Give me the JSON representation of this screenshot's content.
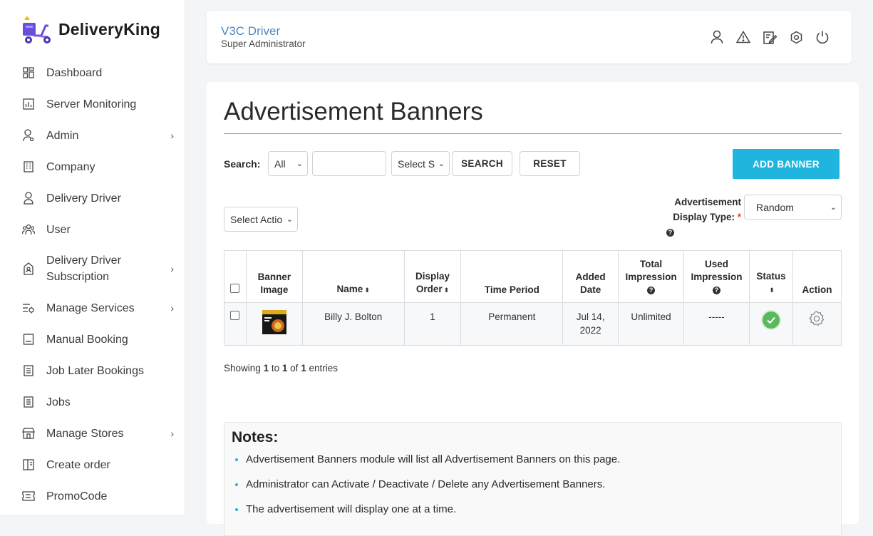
{
  "brand": {
    "name": "DeliveryKing"
  },
  "sidebar": {
    "items": [
      {
        "label": "Dashboard",
        "icon": "dashboard-icon",
        "has_submenu": false
      },
      {
        "label": "Server Monitoring",
        "icon": "chart-icon",
        "has_submenu": false
      },
      {
        "label": "Admin",
        "icon": "admin-user-icon",
        "has_submenu": true
      },
      {
        "label": "Company",
        "icon": "building-icon",
        "has_submenu": false
      },
      {
        "label": "Delivery Driver",
        "icon": "driver-icon",
        "has_submenu": false
      },
      {
        "label": "User",
        "icon": "users-icon",
        "has_submenu": false
      },
      {
        "label": "Delivery Driver Subscription",
        "icon": "subscription-icon",
        "has_submenu": true
      },
      {
        "label": "Manage Services",
        "icon": "services-icon",
        "has_submenu": true
      },
      {
        "label": "Manual Booking",
        "icon": "booking-icon",
        "has_submenu": false
      },
      {
        "label": "Job Later Bookings",
        "icon": "document-icon",
        "has_submenu": false
      },
      {
        "label": "Jobs",
        "icon": "document-icon",
        "has_submenu": false
      },
      {
        "label": "Manage Stores",
        "icon": "store-icon",
        "has_submenu": true
      },
      {
        "label": "Create order",
        "icon": "order-icon",
        "has_submenu": false
      },
      {
        "label": "PromoCode",
        "icon": "promo-icon",
        "has_submenu": false
      }
    ],
    "chevron": "›"
  },
  "header": {
    "title": "V3C Driver",
    "subtitle": "Super Administrator",
    "icons": [
      "profile-icon",
      "alert-icon",
      "edit-icon",
      "settings-icon",
      "power-icon"
    ]
  },
  "page": {
    "title": "Advertisement Banners"
  },
  "toolbar": {
    "search_label": "Search:",
    "filter_value": "All",
    "search_input_value": "",
    "status_select_value": "Select S",
    "search_button": "SEARCH",
    "reset_button": "RESET",
    "add_button": "ADD BANNER",
    "bulk_action_value": "Select Actio",
    "ad_display_label": "Advertisement Display Type:",
    "ad_display_required": "*",
    "ad_display_value": "Random",
    "help_glyph": "?"
  },
  "table": {
    "columns": [
      {
        "label": "",
        "sortable": false
      },
      {
        "label": "Banner Image",
        "sortable": false
      },
      {
        "label": "Name",
        "sortable": true
      },
      {
        "label": "Display Order",
        "sortable": true
      },
      {
        "label": "Time Period",
        "sortable": false
      },
      {
        "label": "Added Date",
        "sortable": false
      },
      {
        "label": "Total Impression",
        "sortable": false,
        "help": true
      },
      {
        "label": "Used Impression",
        "sortable": false,
        "help": true
      },
      {
        "label": "Status",
        "sortable": true
      },
      {
        "label": "Action",
        "sortable": false
      }
    ],
    "sort_glyph": "⬍",
    "rows": [
      {
        "name": "Billy J. Bolton",
        "display_order": "1",
        "time_period": "Permanent",
        "added_date": "Jul 14, 2022",
        "total_impression": "Unlimited",
        "used_impression": "-----",
        "status": "active"
      }
    ]
  },
  "pagination": {
    "showing_prefix": "Showing",
    "from": "1",
    "to_word": "to",
    "to": "1",
    "of_word": "of",
    "total": "1",
    "suffix": "entries"
  },
  "notes": {
    "title": "Notes:",
    "items": [
      "Advertisement Banners module will list all Advertisement Banners on this page.",
      "Administrator can Activate / Deactivate / Delete any Advertisement Banners.",
      "The advertisement will display one at a time."
    ]
  },
  "colors": {
    "accent": "#1fb5de",
    "header_title": "#4f87c2",
    "status_active": "#5cb85c",
    "required": "#e53935"
  }
}
